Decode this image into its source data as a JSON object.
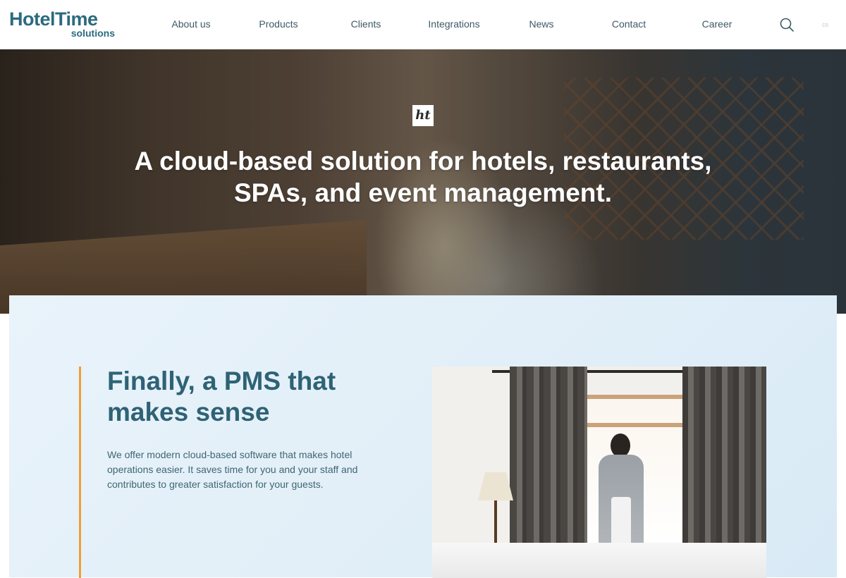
{
  "brand": {
    "name": "HotelTime",
    "tagline": "solutions"
  },
  "nav": {
    "items": [
      {
        "label": "About us"
      },
      {
        "label": "Products"
      },
      {
        "label": "Clients"
      },
      {
        "label": "Integrations"
      },
      {
        "label": "News"
      },
      {
        "label": "Contact"
      },
      {
        "label": "Career"
      }
    ],
    "search_icon": "search-icon",
    "language": "cs"
  },
  "hero": {
    "badge": "ht",
    "title": "A cloud-based solution for hotels, restaurants, SPAs, and event management."
  },
  "intro": {
    "title": "Finally, a PMS that makes sense",
    "text": "We offer modern cloud-based software that makes hotel operations easier. It saves time for you and your staff and contributes to greater satisfaction for your guests."
  },
  "colors": {
    "brand": "#2c6a7e",
    "accent": "#f0a030",
    "card_bg": "#e2eff8"
  }
}
